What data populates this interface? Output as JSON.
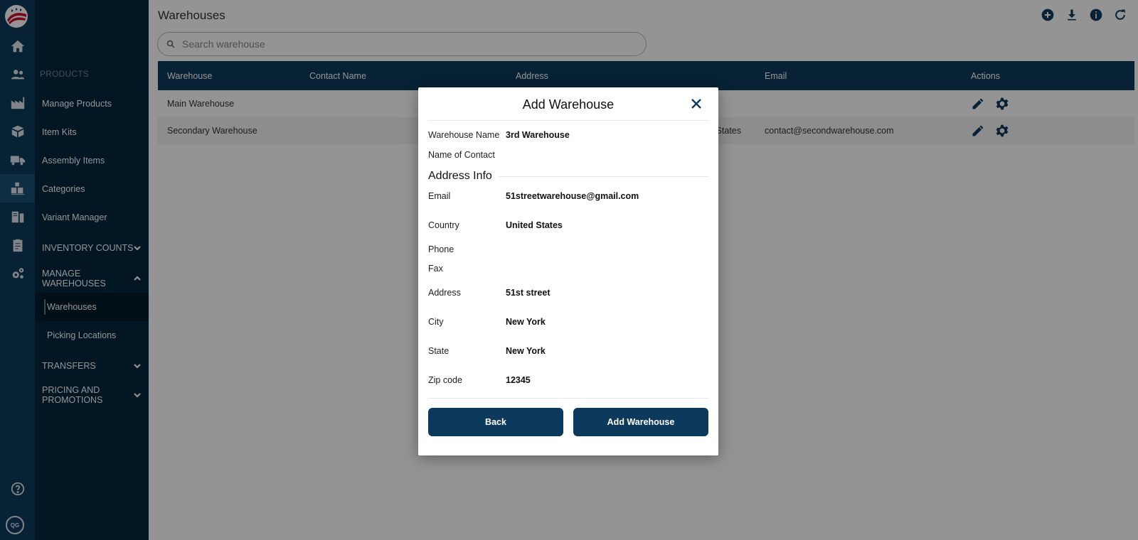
{
  "rail": {
    "icons": [
      "logo-icon",
      "home-icon",
      "users-icon",
      "factory-icon",
      "boxes-icon",
      "truck-icon",
      "inventory-icon",
      "documents-icon",
      "clipboard-icon",
      "gears-icon",
      "help-icon"
    ],
    "avatar_initials": "QG"
  },
  "sidebar": {
    "section_label": "PRODUCTS",
    "items": [
      "Manage Products",
      "Item Kits",
      "Assembly Items",
      "Categories",
      "Variant Manager"
    ],
    "groups": {
      "inventory_counts": "INVENTORY COUNTS",
      "manage_warehouses": "MANAGE WAREHOUSES",
      "transfers": "TRANSFERS",
      "pricing": "PRICING AND PROMOTIONS"
    },
    "sub_items": [
      "Warehouses",
      "Picking Locations"
    ]
  },
  "main": {
    "title": "Warehouses",
    "toolbar_icons": [
      "add-circle-icon",
      "download-icon",
      "info-icon",
      "refresh-icon"
    ],
    "search_placeholder": "Search warehouse",
    "table": {
      "headers": [
        "Warehouse",
        "Contact Name",
        "Address",
        "Email",
        "Actions"
      ],
      "rows": [
        {
          "warehouse": "Main Warehouse",
          "contact": "",
          "address": "",
          "email": ""
        },
        {
          "warehouse": "Secondary Warehouse",
          "contact": "",
          "address": "States",
          "email": "contact@secondwarehouse.com"
        }
      ]
    }
  },
  "modal": {
    "title": "Add Warehouse",
    "fields": {
      "warehouse_name": {
        "label": "Warehouse Name",
        "value": "3rd Warehouse"
      },
      "name_of_contact": {
        "label": "Name of Contact",
        "value": ""
      }
    },
    "section_title": "Address Info",
    "address_fields": {
      "email": {
        "label": "Email",
        "value": "51streetwarehouse@gmail.com"
      },
      "country": {
        "label": "Country",
        "value": "United States"
      },
      "phone": {
        "label": "Phone",
        "value": ""
      },
      "fax": {
        "label": "Fax",
        "value": ""
      },
      "address": {
        "label": "Address",
        "value": "51st street"
      },
      "city": {
        "label": "City",
        "value": "New York"
      },
      "state": {
        "label": "State",
        "value": "New York"
      },
      "zip": {
        "label": "Zip code",
        "value": "12345"
      }
    },
    "back_label": "Back",
    "submit_label": "Add Warehouse"
  },
  "colors": {
    "primary": "#0d3a5c",
    "sidebar_bg": "#04263f",
    "overlay": "rgba(0,0,0,0.42)"
  }
}
